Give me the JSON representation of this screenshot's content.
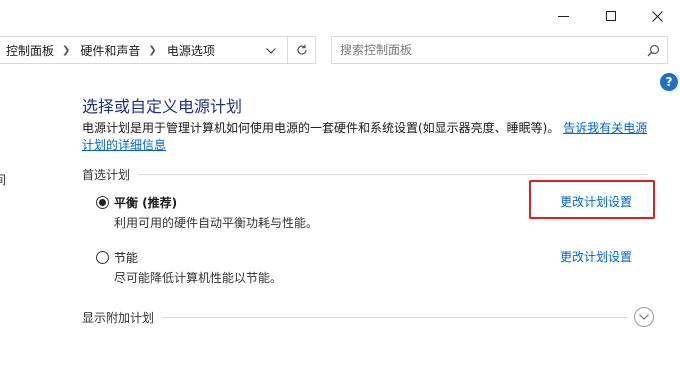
{
  "window": {
    "controls": {
      "minimize": "minimize",
      "maximize": "maximize",
      "close": "close"
    }
  },
  "address": {
    "breadcrumbs": [
      "控制面板",
      "硬件和声音",
      "电源选项"
    ],
    "search_placeholder": "搜索控制面板"
  },
  "left_pane": {
    "fragment": "间"
  },
  "main": {
    "title": "选择或自定义电源计划",
    "description": "电源计划是用于管理计算机如何使用电源的一套硬件和系统设置(如显示器亮度、睡眠等)。",
    "description_link": "告诉我有关电源计划的详细信息",
    "preferred_header": "首选计划",
    "plans": [
      {
        "name": "平衡 (推荐)",
        "description": "利用可用的硬件自动平衡功耗与性能。",
        "selected": true,
        "change_label": "更改计划设置"
      },
      {
        "name": "节能",
        "description": "尽可能降低计算机性能以节能。",
        "selected": false,
        "change_label": "更改计划设置"
      }
    ],
    "extra_header": "显示附加计划"
  },
  "colors": {
    "title": "#1e3287",
    "link": "#0066cc",
    "highlight": "#e02020",
    "help": "#1f6fc5"
  }
}
